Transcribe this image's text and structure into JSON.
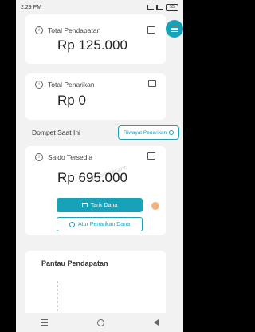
{
  "status_bar": {
    "time": "2:29 PM",
    "battery": "55"
  },
  "cards": {
    "total_pendapatan": {
      "label": "Total Pendapatan",
      "amount": "Rp 125.000"
    },
    "total_penarikan": {
      "label": "Total Penarikan",
      "amount": "Rp 0"
    }
  },
  "wallet": {
    "section_title": "Dompet Saat Ini",
    "history_button": "Riwayat Penarikan",
    "saldo_label": "Saldo Tersedia",
    "saldo_amount": "Rp 695.000",
    "watermark": "@codepicano",
    "withdraw_button": "Tarik Dana",
    "settings_button": "Atur Penarikan Dana"
  },
  "monitor": {
    "title": "Pantau Pendapatan"
  },
  "colors": {
    "accent": "#17a2b8",
    "background": "#f2f2f2",
    "card": "#ffffff"
  }
}
